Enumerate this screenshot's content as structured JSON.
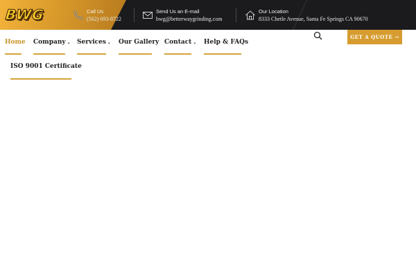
{
  "brand": {
    "logo_text": "BWG"
  },
  "contacts": [
    {
      "icon": "phone-icon",
      "label": "Call Us",
      "value": "(562) 693-8722"
    },
    {
      "icon": "envelope-icon",
      "label": "Send Us an E-mail",
      "value": "bwg@betterwaygrinding.com"
    },
    {
      "icon": "home-icon",
      "label": "Our Location",
      "value": "8333 Chetle Avenue, Santa Fe Springs CA 90670"
    }
  ],
  "nav": {
    "items": [
      {
        "label": "Home",
        "active": true,
        "dropdown": false
      },
      {
        "label": "Company",
        "active": false,
        "dropdown": true
      },
      {
        "label": "Services",
        "active": false,
        "dropdown": true
      },
      {
        "label": "Our Gallery",
        "active": false,
        "dropdown": false
      },
      {
        "label": "Contact",
        "active": false,
        "dropdown": true
      },
      {
        "label": "Help & FAQs",
        "active": false,
        "dropdown": false
      }
    ],
    "cta_label": "GET A QUOTE →"
  },
  "submenu": {
    "items": [
      {
        "label": "ISO 9001 Certificate"
      }
    ]
  },
  "colors": {
    "accent": "#d69c2f",
    "topbar": "#1b1b1d",
    "text": "#1e1e1e"
  }
}
